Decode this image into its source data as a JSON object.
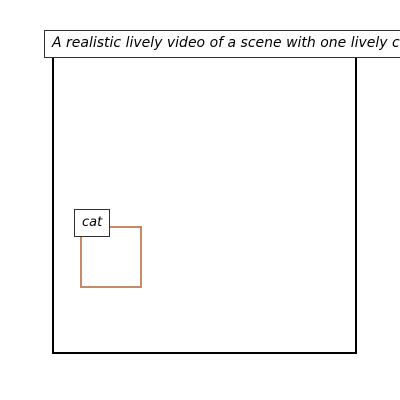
{
  "scene": {
    "caption": "A realistic lively video of a scene with one lively cat"
  },
  "objects": [
    {
      "label": "cat",
      "box_color": "#c58a68"
    }
  ]
}
